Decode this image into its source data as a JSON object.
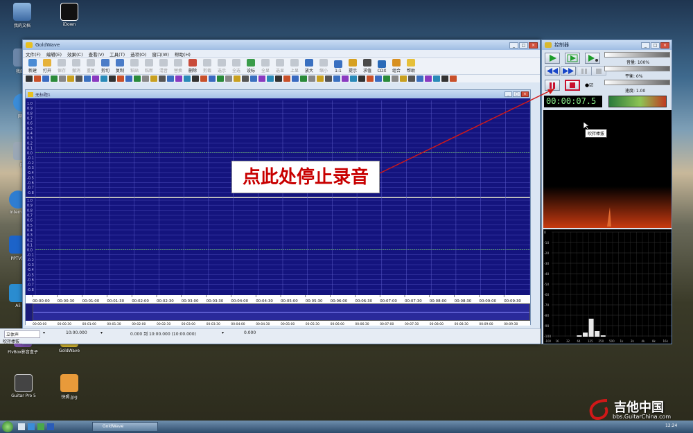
{
  "desktop": {
    "icons": [
      {
        "label": "我的文档"
      },
      {
        "label": "iDown"
      },
      {
        "label": "我的电"
      },
      {
        "label": "网上"
      },
      {
        "label": "回"
      },
      {
        "label": "Internet"
      },
      {
        "label": "PPTV网"
      },
      {
        "label": "Ali"
      },
      {
        "label": "FlvBox影音盒子"
      },
      {
        "label": "GoldWave"
      },
      {
        "label": "Guitar Pro 5"
      },
      {
        "label": "快照.Jpg"
      }
    ]
  },
  "main_window": {
    "title": "GoldWave",
    "menu": [
      "文件(F)",
      "编辑(E)",
      "效果(C)",
      "查看(V)",
      "工具(T)",
      "选项(O)",
      "窗口(W)",
      "帮助(H)"
    ],
    "toolbar": [
      {
        "label": "新建",
        "enabled": true
      },
      {
        "label": "打开",
        "enabled": true
      },
      {
        "label": "保存",
        "enabled": false
      },
      {
        "label": "撤消",
        "enabled": false
      },
      {
        "label": "重复",
        "enabled": false
      },
      {
        "label": "剪切",
        "enabled": true
      },
      {
        "label": "复制",
        "enabled": true
      },
      {
        "label": "粘贴",
        "enabled": false
      },
      {
        "label": "粘新",
        "enabled": false
      },
      {
        "label": "混音",
        "enabled": false
      },
      {
        "label": "替换",
        "enabled": false
      },
      {
        "label": "删除",
        "enabled": true
      },
      {
        "label": "剪裁",
        "enabled": false
      },
      {
        "label": "选示",
        "enabled": false
      },
      {
        "label": "全选",
        "enabled": false
      },
      {
        "label": "设标",
        "enabled": true
      },
      {
        "label": "全显",
        "enabled": false
      },
      {
        "label": "选显",
        "enabled": false
      },
      {
        "label": "上显",
        "enabled": false
      },
      {
        "label": "放大",
        "enabled": true
      },
      {
        "label": "缩小",
        "enabled": false
      },
      {
        "label": "1:1",
        "enabled": true
      },
      {
        "label": "提示",
        "enabled": true
      },
      {
        "label": "求值",
        "enabled": true
      },
      {
        "label": "CDX",
        "enabled": true
      },
      {
        "label": "组合",
        "enabled": true
      },
      {
        "label": "帮助",
        "enabled": true
      }
    ]
  },
  "doc_window": {
    "title": "无标题1",
    "y_labels_top": [
      "1.0",
      "0.9",
      "0.8",
      "0.7",
      "0.6",
      "0.5",
      "0.4",
      "0.3",
      "0.2",
      "0.1",
      "0.0",
      "-0.1",
      "-0.2",
      "-0.3",
      "-0.4",
      "-0.5",
      "-0.6",
      "-0.7",
      "-0.8"
    ],
    "y_labels_bottom": [
      "1.0",
      "0.9",
      "0.8",
      "0.7",
      "0.6",
      "0.5",
      "0.4",
      "0.3",
      "0.2",
      "0.1",
      "0.0",
      "-0.1",
      "-0.2",
      "-0.3",
      "-0.4",
      "-0.5",
      "-0.6",
      "-0.7",
      "-0.8"
    ],
    "time_labels": [
      "00:00:00",
      "00:00:30",
      "00:01:00",
      "00:01:30",
      "00:02:00",
      "00:02:30",
      "00:03:00",
      "00:03:30",
      "00:04:00",
      "00:04:30",
      "00:05:00",
      "00:05:30",
      "00:06:00",
      "00:06:30",
      "00:07:00",
      "00:07:30",
      "00:08:00",
      "00:08:30",
      "00:09:00",
      "00:09:30"
    ]
  },
  "statusbar": {
    "channel": "立体声",
    "length": "10:00.000",
    "selection": "0.000 到 10:00.000 (10:00.000)",
    "position": "0.000",
    "message": "吹拌棒拔"
  },
  "controller": {
    "title": "控制器",
    "volume_label": "音量: 100%",
    "balance_label": "平衡: 0%",
    "speed_label": "速度: 1.00",
    "counter": "00:00:07.5",
    "tooltip": "吹拌棒拔",
    "spectrum_y": [
      "0",
      "-10",
      "-20",
      "-30",
      "-40",
      "-50",
      "-60",
      "-70",
      "-80",
      "-90",
      "-100"
    ],
    "spectrum_x": [
      "-100",
      "16",
      "32",
      "64",
      "125",
      "250",
      "500",
      "1k",
      "2k",
      "4k",
      "8k",
      "16k"
    ]
  },
  "annotation": {
    "text": "点此处停止录音"
  },
  "taskbar": {
    "task": "GoldWave",
    "clock": "12:24"
  },
  "watermark": {
    "line1": "吉他中国",
    "line2": "bbs.GuitarChina.com"
  }
}
